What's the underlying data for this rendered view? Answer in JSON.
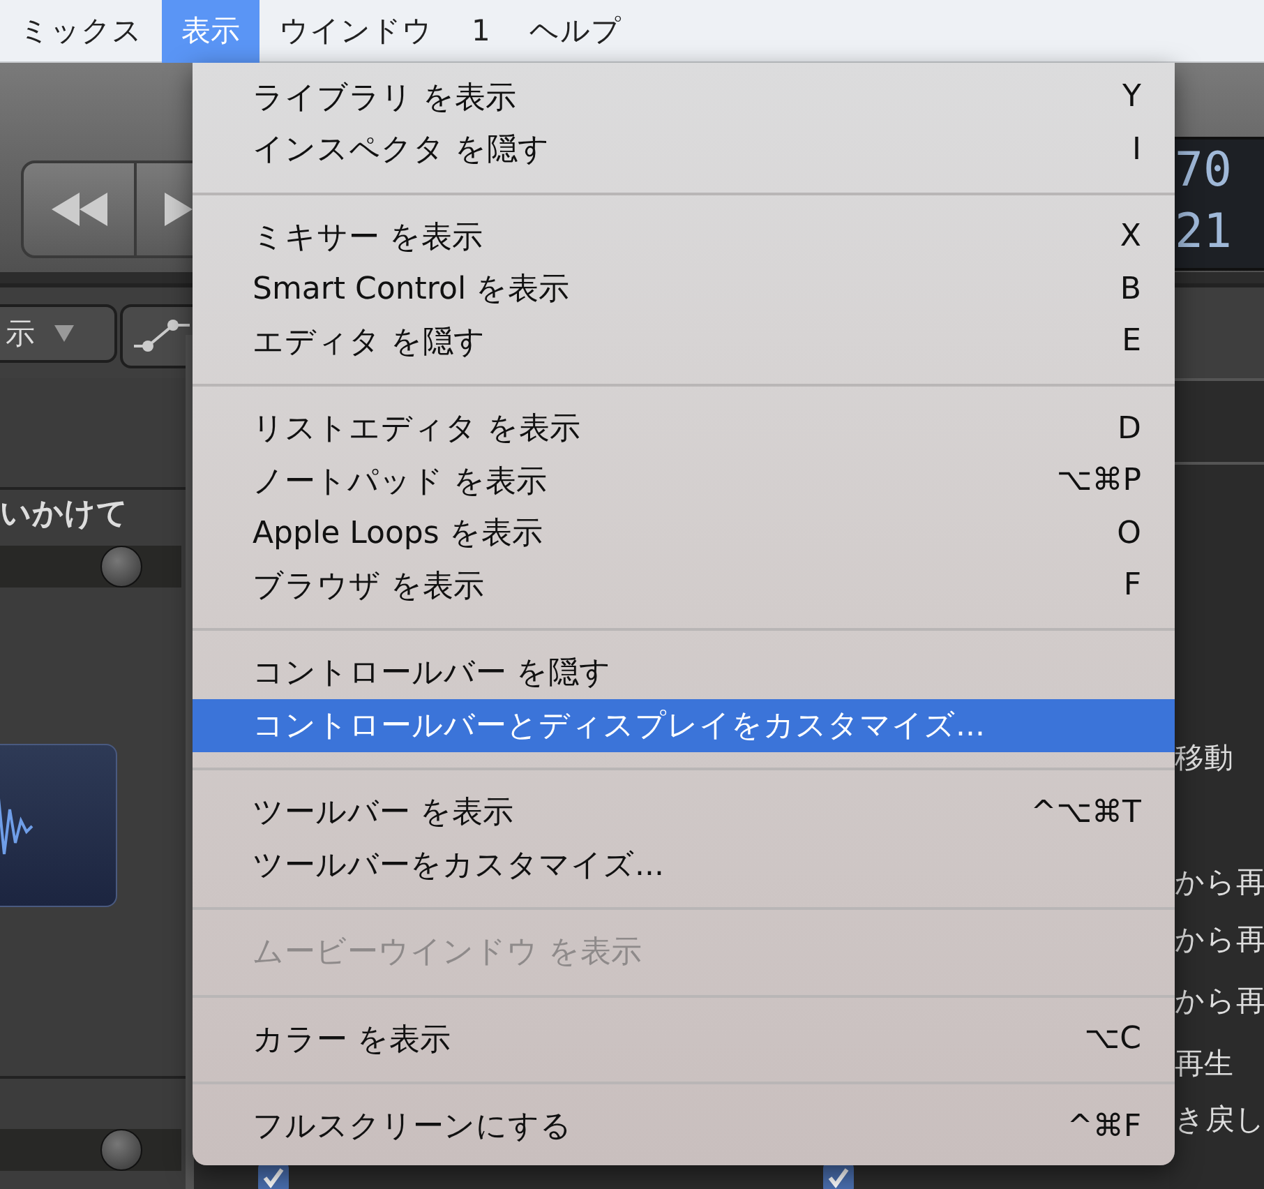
{
  "menubar": [
    {
      "label": "ミックス",
      "selected": false
    },
    {
      "label": "表示",
      "selected": true
    },
    {
      "label": "ウインドウ",
      "selected": false
    },
    {
      "label": "1",
      "selected": false
    },
    {
      "label": "ヘルプ",
      "selected": false
    }
  ],
  "menu": {
    "items": [
      {
        "kind": "item",
        "label": "ライブラリ を表示",
        "shortcut": "Y",
        "disabled": false,
        "selected": false
      },
      {
        "kind": "item",
        "label": "インスペクタ を隠す",
        "shortcut": "I",
        "disabled": false,
        "selected": false
      },
      {
        "kind": "separator"
      },
      {
        "kind": "item",
        "label": "ミキサー を表示",
        "shortcut": "X",
        "disabled": false,
        "selected": false
      },
      {
        "kind": "item",
        "label": "Smart Control を表示",
        "shortcut": "B",
        "disabled": false,
        "selected": false
      },
      {
        "kind": "item",
        "label": "エディタ を隠す",
        "shortcut": "E",
        "disabled": false,
        "selected": false
      },
      {
        "kind": "separator"
      },
      {
        "kind": "item",
        "label": "リストエディタ を表示",
        "shortcut": "D",
        "disabled": false,
        "selected": false
      },
      {
        "kind": "item",
        "label": "ノートパッド を表示",
        "shortcut": "⌥⌘P",
        "disabled": false,
        "selected": false
      },
      {
        "kind": "item",
        "label": "Apple Loops を表示",
        "shortcut": "O",
        "disabled": false,
        "selected": false
      },
      {
        "kind": "item",
        "label": "ブラウザ を表示",
        "shortcut": "F",
        "disabled": false,
        "selected": false
      },
      {
        "kind": "separator"
      },
      {
        "kind": "item",
        "label": "コントロールバー を隠す",
        "disabled": false,
        "selected": false
      },
      {
        "kind": "item",
        "label": "コントロールバーとディスプレイをカスタマイズ...",
        "disabled": false,
        "selected": true
      },
      {
        "kind": "separator"
      },
      {
        "kind": "item",
        "label": "ツールバー を表示",
        "shortcut": "^⌥⌘T",
        "disabled": false,
        "selected": false
      },
      {
        "kind": "item",
        "label": "ツールバーをカスタマイズ...",
        "disabled": false,
        "selected": false
      },
      {
        "kind": "separator"
      },
      {
        "kind": "item",
        "label": "ムービーウインドウ を表示",
        "disabled": true,
        "selected": false
      },
      {
        "kind": "separator"
      },
      {
        "kind": "item",
        "label": "カラー を表示",
        "shortcut": "⌥C",
        "disabled": false,
        "selected": false
      },
      {
        "kind": "separator"
      },
      {
        "kind": "item",
        "label": "フルスクリーンにする",
        "shortcut": "^⌘F",
        "disabled": false,
        "selected": false
      }
    ]
  },
  "background": {
    "lcd": [
      "70",
      "21"
    ],
    "dropdown": "示",
    "left_panel_label": "いかけて",
    "right_panel_texts": [
      "移動",
      "から再",
      "から再",
      "から再",
      "再生",
      "き戻し"
    ],
    "checkboxes": [
      {
        "checked": true
      },
      {
        "checked": true
      }
    ]
  }
}
